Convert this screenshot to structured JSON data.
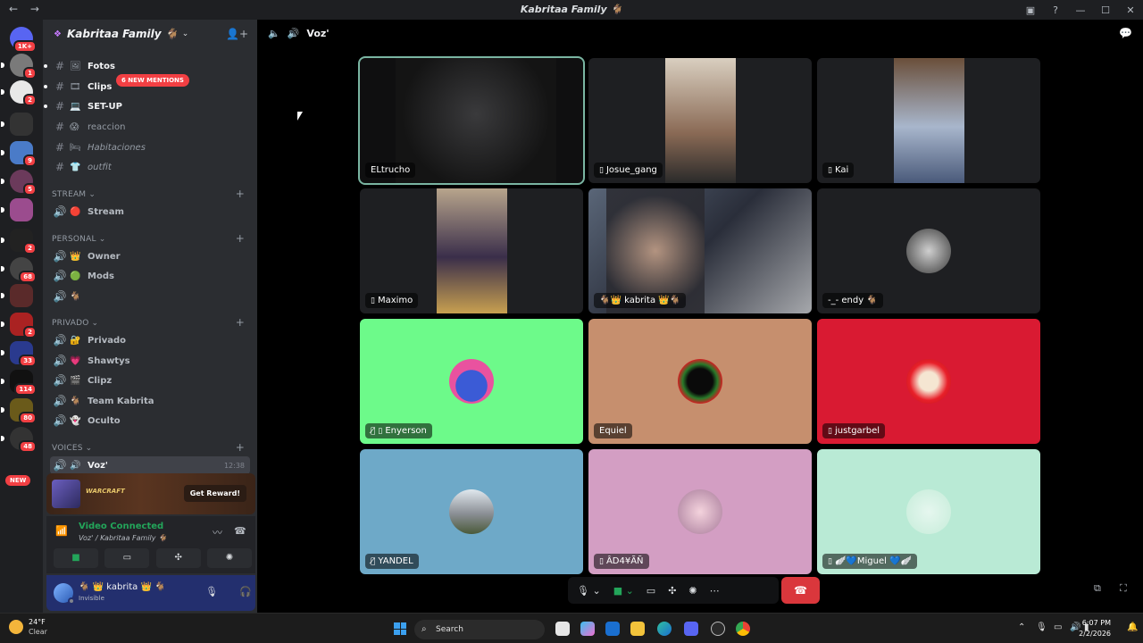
{
  "window": {
    "title": "Kabritaa Family 🐐",
    "back": "←",
    "forward": "→"
  },
  "servers": {
    "badges": [
      "1K+",
      "1",
      "2",
      "",
      "9",
      "5",
      "",
      "2",
      "68",
      "",
      "2",
      "33",
      "114",
      "80",
      "48"
    ],
    "new_label": "NEW"
  },
  "server": {
    "name": "Kabritaa Family 🐐",
    "mentions": "6 NEW MENTIONS"
  },
  "channels": {
    "text": [
      {
        "emoji": "🖼",
        "label": "Fotos"
      },
      {
        "emoji": "🎞",
        "label": "Clips"
      },
      {
        "emoji": "💻",
        "label": "SET-UP"
      },
      {
        "emoji": "😱",
        "label": "reaccion"
      },
      {
        "emoji": "🛏",
        "label": "Habitaciones"
      },
      {
        "emoji": "👕",
        "label": "outfit"
      }
    ],
    "categories": {
      "stream": "STREAM",
      "personal": "PERSONAL",
      "privado": "PRIVADO",
      "voices": "VOICES"
    },
    "stream": [
      {
        "emoji": "🔴",
        "label": "Stream"
      }
    ],
    "personal": [
      {
        "emoji": "👑",
        "label": "Owner"
      },
      {
        "emoji": "🟢",
        "label": "Mods"
      },
      {
        "emoji": "🐐",
        "label": ""
      }
    ],
    "privado": [
      {
        "emoji": "🔐",
        "label": "Privado"
      },
      {
        "emoji": "💗",
        "label": "Shawtys"
      },
      {
        "emoji": "🎬",
        "label": "Clipz"
      },
      {
        "emoji": "🐐",
        "label": "Team Kabrita"
      },
      {
        "emoji": "👻",
        "label": "Oculto"
      }
    ],
    "voices": [
      {
        "label": "Voz'",
        "time": "12:38"
      }
    ]
  },
  "promo": {
    "brand": "WARCRAFT",
    "button": "Get Reward!"
  },
  "voice_panel": {
    "status": "Video Connected",
    "sub": "Voz' / Kabritaa Family 🐐"
  },
  "user_panel": {
    "name": "🐐 👑 kabrita 👑 🐐",
    "status": "Invisible"
  },
  "main": {
    "channel": "Voz'"
  },
  "participants": [
    {
      "name": "ELtrucho",
      "mobile": false
    },
    {
      "name": "Josue_gang",
      "mobile": true
    },
    {
      "name": "Kai",
      "mobile": true
    },
    {
      "name": "Maximo",
      "mobile": true
    },
    {
      "name": "🐐👑 kabrita 👑🐐",
      "mobile": false
    },
    {
      "name": "-_- endy 🐐",
      "mobile": false
    },
    {
      "name": "Enyerson",
      "mobile": true
    },
    {
      "name": "Equiel",
      "mobile": false
    },
    {
      "name": "justgarbel",
      "mobile": true
    },
    {
      "name": "YANDEL",
      "mobile": false
    },
    {
      "name": "ÂD4¥ÃÑ",
      "mobile": false
    },
    {
      "name": "🪽💙Miguel 💙🪽",
      "mobile": true
    }
  ],
  "taskbar": {
    "temp": "24°F",
    "weather": "Clear",
    "search": "Search",
    "time": "6:07 PM",
    "date": "2/2/2026"
  },
  "colors": {
    "accent_green": "#23a55a",
    "danger": "#da373c",
    "tile_green": "#6dfa8a",
    "tile_brown": "#c68f6e",
    "tile_red": "#d91a32",
    "tile_blue": "#6ea9c8",
    "tile_pink": "#d39ec3",
    "tile_mint": "#b9ead5"
  }
}
